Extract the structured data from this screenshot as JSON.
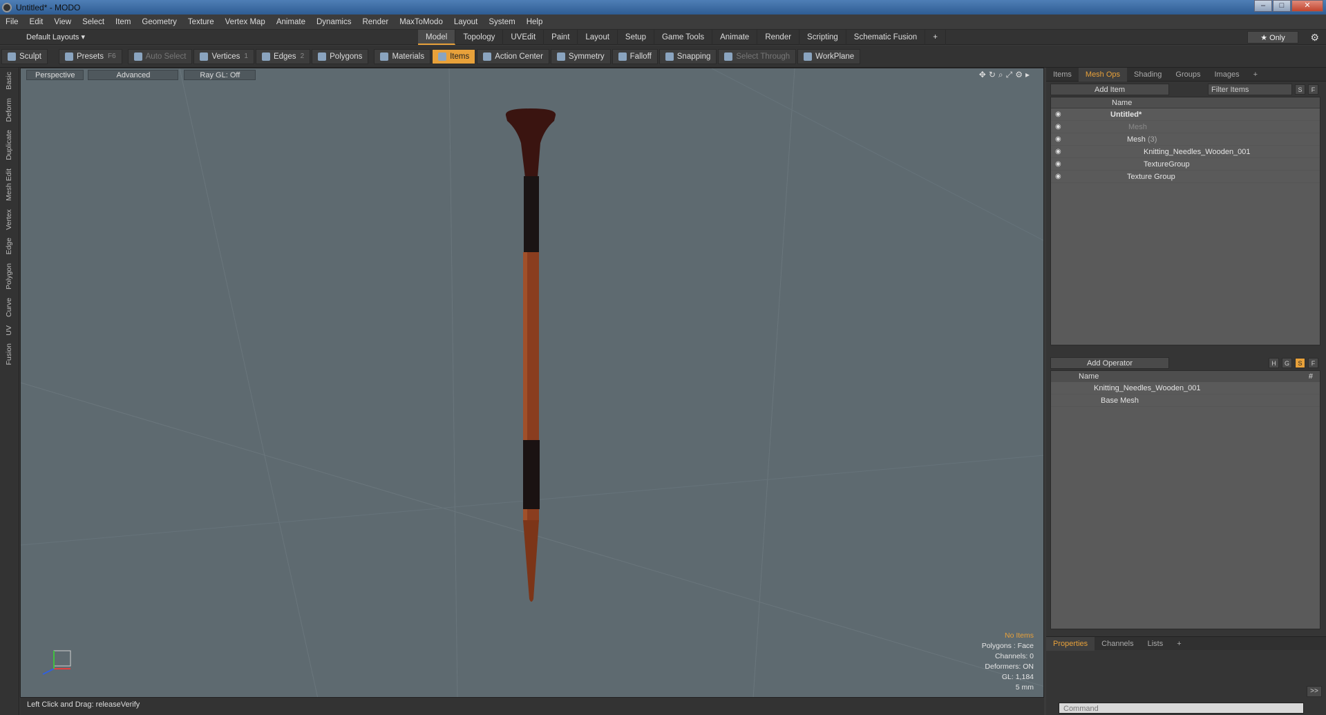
{
  "window": {
    "title": "Untitled* - MODO",
    "min": "–",
    "max": "□",
    "close": "✕"
  },
  "menu": [
    "File",
    "Edit",
    "View",
    "Select",
    "Item",
    "Geometry",
    "Texture",
    "Vertex Map",
    "Animate",
    "Dynamics",
    "Render",
    "MaxToModo",
    "Layout",
    "System",
    "Help"
  ],
  "layout": {
    "default_layouts": "Default Layouts ▾",
    "tabs": [
      "Model",
      "Topology",
      "UVEdit",
      "Paint",
      "Layout",
      "Setup",
      "Game Tools",
      "Animate",
      "Render",
      "Scripting",
      "Schematic Fusion",
      "+"
    ],
    "active_tab": "Model",
    "only": "★ Only"
  },
  "toolbar": {
    "sculpt": "Sculpt",
    "presets": "Presets",
    "presets_key": "F6",
    "auto_select": "Auto Select",
    "vertices": "Vertices",
    "vertices_key": "1",
    "edges": "Edges",
    "edges_key": "2",
    "polygons": "Polygons",
    "materials": "Materials",
    "items": "Items",
    "action_center": "Action Center",
    "symmetry": "Symmetry",
    "falloff": "Falloff",
    "snapping": "Snapping",
    "select_through": "Select Through",
    "workplane": "WorkPlane"
  },
  "left_tabs": [
    "Basic",
    "Deform",
    "Duplicate",
    "Mesh Edit",
    "Vertex",
    "Edge",
    "Polygon",
    "Curve",
    "UV",
    "Fusion"
  ],
  "viewport": {
    "perspective": "Perspective",
    "advanced": "Advanced",
    "raygl": "Ray GL: Off",
    "stats": {
      "no_items": "No Items",
      "polygons": "Polygons : Face",
      "channels": "Channels: 0",
      "deformers": "Deformers: ON",
      "gl": "GL: 1,184",
      "scale": "5 mm"
    }
  },
  "status": "Left Click and Drag:   releaseVerify",
  "items_panel": {
    "tabs": [
      "Items",
      "Mesh Ops",
      "Shading",
      "Groups",
      "Images",
      "+"
    ],
    "active_tab": "Mesh Ops",
    "add_item": "Add Item",
    "filter": "Filter Items",
    "s": "S",
    "f": "F",
    "name_col": "Name",
    "rows": [
      {
        "label": "Untitled*",
        "count": ""
      },
      {
        "label": "Mesh",
        "count": ""
      },
      {
        "label": "Mesh",
        "count": "(3)"
      },
      {
        "label": "Knitting_Needles_Wooden_001",
        "count": ""
      },
      {
        "label": "TextureGroup",
        "count": ""
      },
      {
        "label": "Texture Group",
        "count": ""
      }
    ]
  },
  "operator_panel": {
    "add_operator": "Add Operator",
    "h": "H",
    "g": "G",
    "s": "S",
    "f": "F",
    "name_col": "Name",
    "hash": "#",
    "rows": [
      {
        "label": "Knitting_Needles_Wooden_001"
      },
      {
        "label": "Base Mesh"
      }
    ]
  },
  "properties_panel": {
    "tabs": [
      "Properties",
      "Channels",
      "Lists",
      "+"
    ],
    "active_tab": "Properties",
    "expand": ">>",
    "command_placeholder": "Command"
  }
}
